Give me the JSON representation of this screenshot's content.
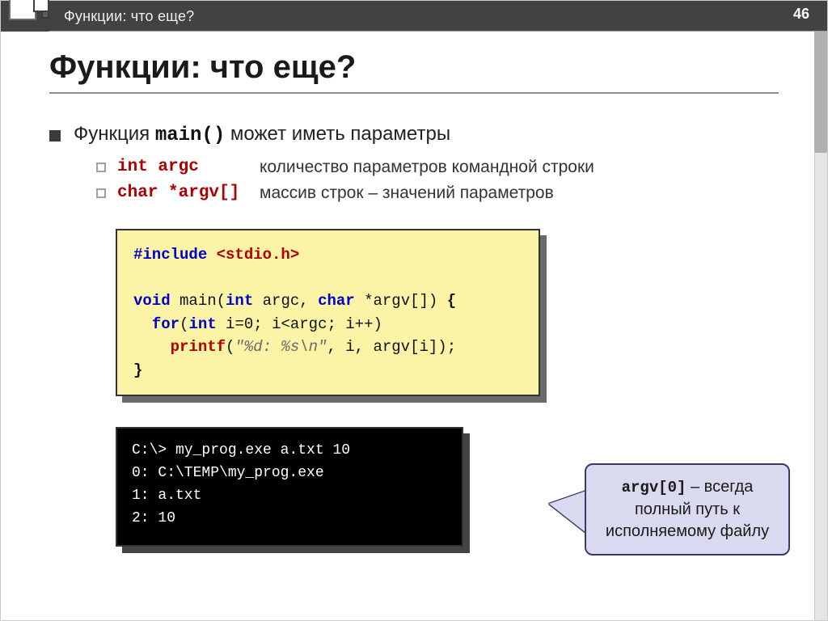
{
  "header": {
    "title": "Функции: что еще?",
    "page_number": "46"
  },
  "main_title": "Функции: что еще?",
  "bullets": {
    "l1_prefix": "Функция ",
    "l1_main": "main()",
    "l1_suffix": " может иметь параметры",
    "params": [
      {
        "kw": "int argc",
        "desc": "количество параметров командной строки"
      },
      {
        "kw": "char *argv[]",
        "desc": "массив строк – значений параметров"
      }
    ]
  },
  "code": {
    "include_kw": "#include",
    "include_lib": " <stdio.h>",
    "void": "void",
    "main_sig_1": " main(",
    "int": "int",
    "argc": " argc, ",
    "char": "char",
    "argv": " *argv[]) ",
    "lbrace": "{",
    "indent1": "  ",
    "for": "for",
    "for_open": "(",
    "int2": "int",
    "for_body": " i=0; i<argc; i++)",
    "indent2": "    ",
    "printf": "printf",
    "pr_open": "(",
    "str": "\"%d: %s\\n\"",
    "pr_rest": ", i, argv[i]);",
    "rbrace": "}"
  },
  "terminal": {
    "line1": "C:\\> my_prog.exe a.txt 10",
    "line2": "0: C:\\TEMP\\my_prog.exe",
    "line3": "1: a.txt",
    "line4": "2: 10"
  },
  "callout": {
    "argv0": "argv[0]",
    "rest": " – всегда полный путь к исполняемому файлу"
  }
}
